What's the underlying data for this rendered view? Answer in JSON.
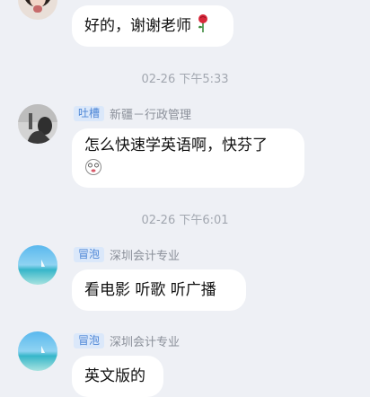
{
  "messages": [
    {
      "text": "好的，谢谢老师",
      "emoji": "rose-icon"
    },
    {
      "timestamp": "02-26 下午5:33",
      "badge": "吐槽",
      "author": "新疆－行政管理",
      "text": "怎么快速学英语啊，快芬了",
      "emoji": "dizzy-face-icon"
    },
    {
      "timestamp": "02-26 下午6:01",
      "badge": "冒泡",
      "author": "深圳会计专业",
      "text": "看电影 听歌 听广播"
    },
    {
      "badge": "冒泡",
      "author": "深圳会计专业",
      "text": "英文版的"
    }
  ],
  "colors": {
    "background": "#eef0f5",
    "bubble": "#ffffff",
    "badge_bg": "#dbe8fa",
    "badge_text": "#4d86d6"
  }
}
